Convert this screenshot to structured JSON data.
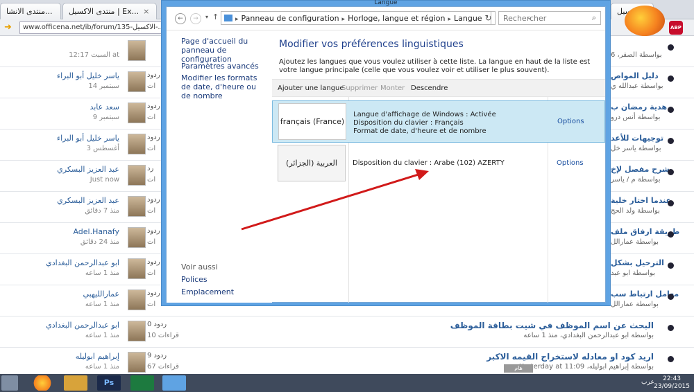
{
  "browser": {
    "tabs": [
      {
        "label": "منتدى الاكسيل | Ex..."
      },
      {
        "label": "منتدى الانشا..."
      },
      {
        "label": "منتدى الاكسيل | Top.toP"
      }
    ],
    "url": "www.officena.net/ib/forum/135-الاكسيل-..."
  },
  "forum": {
    "rows": [
      {
        "user": "",
        "time": "السبت 12:17 at",
        "replies": "",
        "views": "",
        "title": "",
        "sub": "",
        "right_title": "",
        "right_sub": "بواسطة الصقر، 6"
      },
      {
        "user": "ياسر خليل أبو البراء",
        "time": "14 سبتمبر",
        "replies": "ردود",
        "views": "ات",
        "title": "",
        "sub": "",
        "right_title": "دليل المواص",
        "right_sub": "بواسطة عبدالله ي"
      },
      {
        "user": "سعد عابد",
        "time": "9 سبتمبر",
        "replies": "ردود",
        "views": "ات",
        "title": "",
        "sub": "",
        "right_title": "هدية رمضان ب",
        "right_sub": "بواسطة أنس درو"
      },
      {
        "user": "ياسر خليل أبو البراء",
        "time": "3 أغسطس",
        "replies": "ردود",
        "views": "ات",
        "title": "",
        "sub": "",
        "right_title": "توجيهات للأعد",
        "right_sub": "بواسطة ياسر خل"
      },
      {
        "user": "عبد العزيز البسكري",
        "time": "Just now",
        "replies": "رد",
        "views": "ات",
        "title": "",
        "sub": "",
        "right_title": "شرح مفصل لإخ",
        "right_sub": "بواسطة م / ياسر"
      },
      {
        "user": "عبد العزيز البسكري",
        "time": "منذ 7 دقائق",
        "replies": "ردود",
        "views": "ات",
        "title": "",
        "sub": "",
        "right_title": "عندما اختار خلية",
        "right_sub": "بواسطة ولد الحج"
      },
      {
        "user": "Adel.Hanafy",
        "time": "منذ 24 دقائق",
        "replies": "ردود",
        "views": "ات",
        "title": "",
        "sub": "",
        "right_title": "طريقة ارفاق ملف",
        "right_sub": "بواسطة عمارالل"
      },
      {
        "user": "ابو عبدالرحمن البغدادي",
        "time": "منذ 1 ساعه",
        "replies": "ردود",
        "views": "ات",
        "title": "",
        "sub": "",
        "right_title": "الترحيل بشكل",
        "right_sub": "بواسطة ابو عبد"
      },
      {
        "user": "عمارالليهبي",
        "time": "منذ 1 ساعه",
        "replies": "ردود",
        "views": "ات",
        "title": "",
        "sub": "",
        "right_title": "معامل ارتباط سب",
        "right_sub": "بواسطة عمارالل"
      },
      {
        "user": "ابو عبدالرحمن البغدادي",
        "time": "منذ 1 ساعه",
        "replies": "0 ردود",
        "views": "10 قراءات",
        "title": "البحث عن اسم الموظف في شيت بطاقة الموظف",
        "sub": "بواسطة ابو عبدالرحمن البغدادي، منذ 1 ساعه",
        "right_title": "",
        "right_sub": ""
      },
      {
        "user": "إبراهيم ابوليله",
        "time": "منذ 1 ساعه",
        "replies": "9 ردود",
        "views": "67 قراءات",
        "title": "اريد كود او معادله لاستخراج القيمه الاكبر",
        "sub": "بواسطة إبراهيم ابوليله، Yesterday at 11:09",
        "right_title": "",
        "right_sub": ""
      }
    ],
    "tag_label": "هام"
  },
  "window": {
    "title": "Langue",
    "breadcrumb": [
      "Panneau de configuration",
      "Horloge, langue et région",
      "Langue"
    ],
    "search_placeholder": "Rechercher",
    "sidebar": {
      "home": "Page d'accueil du panneau de configuration",
      "advanced": "Paramètres avancés",
      "formats": "Modifier les formats de date, d'heure ou de nombre",
      "see_also": "Voir aussi",
      "fonts": "Polices",
      "location": "Emplacement"
    },
    "heading": "Modifier vos préférences linguistiques",
    "description": "Ajoutez les langues que vous voulez utiliser à cette liste. La langue en haut de la liste est votre langue principale (celle que vous voulez voir et utiliser le plus souvent).",
    "toolbar": {
      "add": "Ajouter une langue",
      "remove": "Supprimer",
      "up": "Monter",
      "down": "Descendre"
    },
    "languages": [
      {
        "name": "français (France)",
        "info": [
          "Langue d'affichage de Windows : Activée",
          "Disposition du clavier : Français",
          "Format de date, d'heure et de nombre"
        ],
        "options": "Options",
        "selected": true
      },
      {
        "name": "العربية (الجزائر)",
        "info": [
          "Disposition du clavier : Arabe (102) AZERTY"
        ],
        "options": "Options",
        "selected": false
      }
    ]
  },
  "taskbar": {
    "lang": "عرب",
    "time": "22:43",
    "date": "23/09/2015"
  },
  "colors": {
    "window_frame": "#5fa3e3",
    "selected_row": "#cce8f4",
    "link": "#1a3a7a",
    "heading": "#1e3f8c",
    "arrow": "#d11a1a",
    "taskbar": "#3f4a5c"
  }
}
